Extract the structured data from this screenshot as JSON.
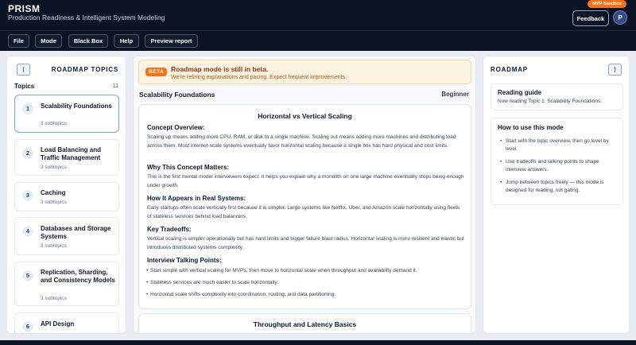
{
  "header": {
    "brand": "PRISM",
    "tagline": "Production Readiness & Intelligent System Modeling",
    "sandbox_badge": "MVP Sandbox",
    "feedback_label": "Feedback",
    "avatar_initial": "P"
  },
  "toolbar": {
    "file": "File",
    "mode": "Mode",
    "black_box": "Black Box",
    "help": "Help",
    "preview_report": "Preview report"
  },
  "left": {
    "collapse_glyph": "⟨",
    "heading": "ROADMAP TOPICS",
    "topics_label": "Topics",
    "topics_count": "11",
    "topics": [
      {
        "num": "1",
        "title": "Scalability Foundations",
        "sub": "3 subtopics"
      },
      {
        "num": "2",
        "title": "Load Balancing and Traffic Management",
        "sub": "3 subtopics"
      },
      {
        "num": "3",
        "title": "Caching",
        "sub": "3 subtopics"
      },
      {
        "num": "4",
        "title": "Databases and Storage Systems",
        "sub": "3 subtopics"
      },
      {
        "num": "5",
        "title": "Replication, Sharding, and Consistency Models",
        "sub": "3 subtopics"
      },
      {
        "num": "6",
        "title": "API Design",
        "sub": ""
      }
    ]
  },
  "center": {
    "beta_pill": "BETA",
    "beta_title": "Roadmap mode is still in beta.",
    "beta_text": "We're refining explanations and pacing. Expect frequent improvements.",
    "section_title": "Scalability Foundations",
    "level": "Beginner",
    "concept": {
      "heading": "Horizontal vs Vertical Scaling",
      "overview_h": "Concept Overview:",
      "overview": "Scaling up means adding more CPU, RAM, or disk to a single machine. Scaling out means adding more machines and distributing load across them. Most internet-scale systems eventually favor horizontal scaling because a single box has hard physical and cost limits.",
      "why_h": "Why This Concept Matters:",
      "why": "This is the first mental model interviewers expect. It helps you explain why a monolith on one large machine eventually stops being enough under growth.",
      "how_h": "How It Appears in Real Systems:",
      "how": "Early startups often scale vertically first because it is simpler. Large systems like Netflix, Uber, and Amazon scale horizontally using fleets of stateless services behind load balancers.",
      "trade_h": "Key Tradeoffs:",
      "trade": "Vertical scaling is simpler operationally but has hard limits and bigger failure blast radius. Horizontal scaling is more resilient and elastic but introduces distributed systems complexity.",
      "talk_h": "Interview Talking Points:",
      "talk": [
        "Start simple with vertical scaling for MVPs, then move to horizontal scale when throughput and availability demand it.",
        "Stateless services are much easier to scale horizontally.",
        "Horizontal scale shifts complexity into coordination, routing, and data partitioning."
      ]
    },
    "next_title": "Throughput and Latency Basics"
  },
  "right": {
    "heading": "ROADMAP",
    "collapse_glyph": "⟩",
    "guide_title": "Reading guide",
    "guide_text": "Now reading Topic 1: Scalability Foundations.",
    "howto_title": "How to use this mode",
    "howto": [
      "Start with the topic overview, then go level by level.",
      "Use tradeoffs and talking points to shape interview answers.",
      "Jump between topics freely — this mode is designed for reading, not gating."
    ]
  }
}
